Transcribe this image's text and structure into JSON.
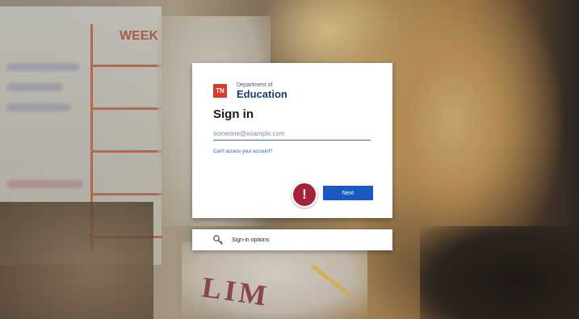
{
  "background": {
    "whiteboard_heading": "WEEK",
    "shirt_text": "LIM"
  },
  "signin_card": {
    "logo": {
      "badge_text": "TN",
      "department": "Department of",
      "name": "Education"
    },
    "title": "Sign in",
    "email_placeholder": "someone@example.com",
    "email_value": "",
    "cant_access_link": "Can't access your account?",
    "next_button": "Next",
    "alert_badge": "!"
  },
  "signin_options": {
    "label": "Sign-in options",
    "icon": "key-icon"
  },
  "colors": {
    "next_button": "#1a5bc2",
    "link": "#1d5fbf",
    "logo_mark": "#d83b2b",
    "alert_badge": "#a6223a"
  }
}
